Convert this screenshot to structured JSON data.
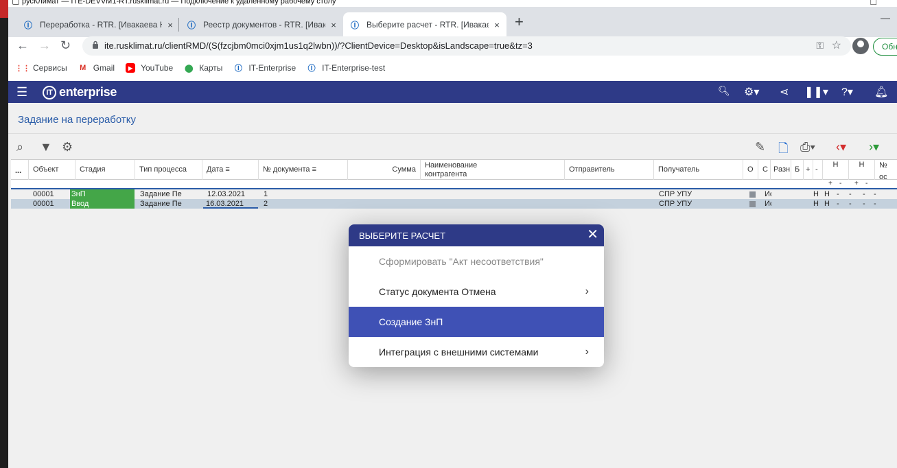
{
  "remote_title": "русКлимат — ITE-DEVVM1-RT.rusklimat.ru — Подключение к удаленному рабочему столу",
  "tabs": [
    {
      "label": "Переработка - RTR. [Ивакаева Н",
      "close": "×"
    },
    {
      "label": "Реестр документов - RTR. [Ивак",
      "close": "×"
    },
    {
      "label": "Выберите расчет - RTR. [Ивакае",
      "close": "×"
    }
  ],
  "new_tab": "+",
  "address": {
    "url": "ite.rusklimat.ru/clientRMD/(S(fzcjbm0mci0xjm1us1q2lwbn))/?ClientDevice=Desktop&isLandscape=true&tz=3",
    "update_label": "Обн"
  },
  "bookmarks": [
    {
      "label": "Сервисы",
      "color": "#ea4335"
    },
    {
      "label": "Gmail",
      "color": "#d93025"
    },
    {
      "label": "YouTube",
      "color": "#ff0000"
    },
    {
      "label": "Карты",
      "color": "#34a853"
    },
    {
      "label": "IT-Enterprise",
      "color": "#1565c0"
    },
    {
      "label": "IT-Enterprise-test",
      "color": "#1565c0"
    }
  ],
  "app": {
    "logo": "enterprise",
    "page_title": "Задание на переработку"
  },
  "grid": {
    "headers": {
      "dots": "...",
      "object": "Объект",
      "stage": "Стадия",
      "proc_type": "Тип процесса",
      "date": "Дата",
      "doc_no": "№ документа",
      "sum": "Сумма",
      "counterparty_1": "Наименование",
      "counterparty_2": "контрагента",
      "sender": "Отправитель",
      "receiver": "Получатель",
      "o": "О",
      "c": "С",
      "raz": "Разн",
      "b": "Б",
      "plus": "+",
      "minus": "-",
      "n1": "Н",
      "n2": "Н",
      "no": "№",
      "oc": "ос"
    },
    "subheader": [
      "+",
      "-",
      "+",
      "-"
    ],
    "rows": [
      {
        "object": "00001",
        "stage": "ЗнП",
        "proc_type": "Задание Пе",
        "date": "12.03.2021",
        "doc_no": "1",
        "receiver": "СПР УПУ",
        "c": "Ис",
        "f1": "Н",
        "f2": "Н",
        "d1": "-",
        "d2": "-",
        "d3": "-",
        "d4": "-"
      },
      {
        "object": "00001",
        "stage": "Ввод",
        "proc_type": "Задание Пе",
        "date": "16.03.2021",
        "doc_no": "2",
        "receiver": "СПР УПУ",
        "c": "Ис",
        "f1": "Н",
        "f2": "Н",
        "d1": "-",
        "d2": "-",
        "d3": "-",
        "d4": "-"
      }
    ]
  },
  "modal": {
    "title": "ВЫБЕРИТЕ РАСЧЕТ",
    "items": [
      {
        "label": "Сформировать \"Акт несоответствия\""
      },
      {
        "label": "Статус документа Отмена"
      },
      {
        "label": "Создание ЗнП"
      },
      {
        "label": "Интеграция с внешними системами"
      }
    ]
  }
}
